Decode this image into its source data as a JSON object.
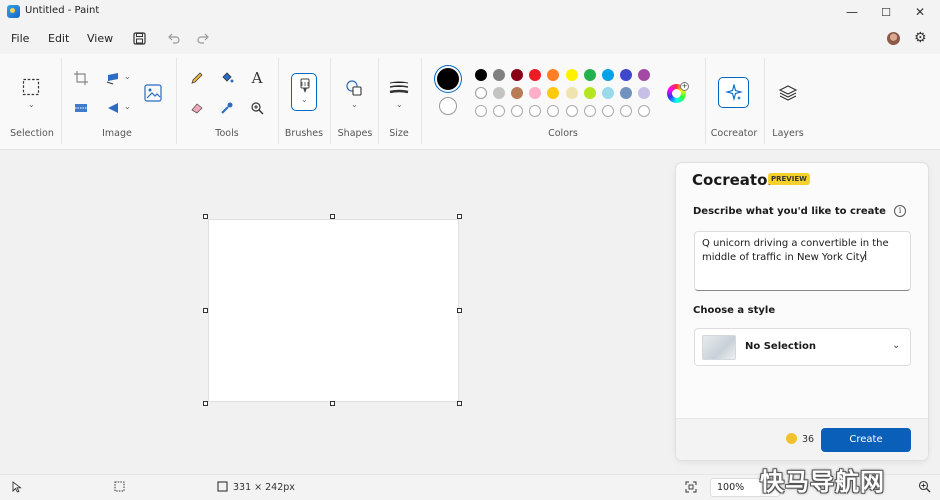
{
  "window": {
    "title": "Untitled - Paint",
    "minimize": "—",
    "maximize": "☐",
    "close": "✕"
  },
  "menu": {
    "items": [
      "File",
      "Edit",
      "View"
    ]
  },
  "ribbon": {
    "groups": {
      "selection": "Selection",
      "image": "Image",
      "tools": "Tools",
      "brushes": "Brushes",
      "shapes": "Shapes",
      "size": "Size",
      "colors": "Colors",
      "cocreator": "Cocreator",
      "layers": "Layers"
    },
    "text_tool_glyph": "A",
    "colors": {
      "primary": "#000000",
      "secondary": "#ffffff",
      "palette_row1": [
        "#000000",
        "#7f7f7f",
        "#880015",
        "#ed1c24",
        "#ff7f27",
        "#fff200",
        "#22b14c",
        "#00a2e8",
        "#3f48cc",
        "#a349a4"
      ],
      "palette_row2": [
        "#ffffff",
        "#c3c3c3",
        "#b97a57",
        "#ffaec9",
        "#ffc90e",
        "#efe4b0",
        "#b5e61d",
        "#99d9ea",
        "#7092be",
        "#c8bfe7"
      ],
      "palette_row3_count": 10
    }
  },
  "cocreator": {
    "title": "Cocreator",
    "badge": "PREVIEW",
    "prompt_label": "Describe what you'd like to create",
    "prompt_text": "Q unicorn driving a convertible in the middle of traffic in New York City.",
    "style_label": "Choose a style",
    "style_value": "No Selection",
    "credits": "36",
    "create_label": "Create"
  },
  "status": {
    "canvas_size": "331 × 242px",
    "zoom": "100%"
  },
  "watermark": "快马导航网",
  "accent": "#0067c0"
}
